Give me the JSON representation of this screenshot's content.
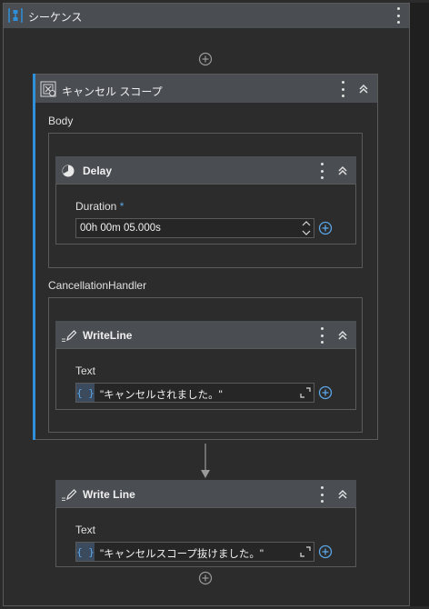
{
  "sequence": {
    "title": "シーケンス",
    "icon": "sequence-icon"
  },
  "cancel_scope": {
    "title": "キャンセル スコープ",
    "icon": "cancel-scope-icon",
    "body_label": "Body",
    "handler_label": "CancellationHandler"
  },
  "delay": {
    "title": "Delay",
    "icon": "clock-icon",
    "duration_label": "Duration",
    "required_mark": "*",
    "duration_value": "00h 00m 05.000s"
  },
  "writeline1": {
    "title": "WriteLine",
    "icon": "pencil-icon",
    "text_label": "Text",
    "brace": "{ }",
    "text_value": "\"キャンセルされました。\""
  },
  "writeline2": {
    "title": "Write Line",
    "icon": "pencil-icon",
    "text_label": "Text",
    "brace": "{ }",
    "text_value": "\"キャンセルスコープ抜けました。\""
  },
  "colors": {
    "accent": "#2f8fd8",
    "header": "#4a4d52",
    "background": "#2b2b2b",
    "border": "#5a5a5a"
  }
}
